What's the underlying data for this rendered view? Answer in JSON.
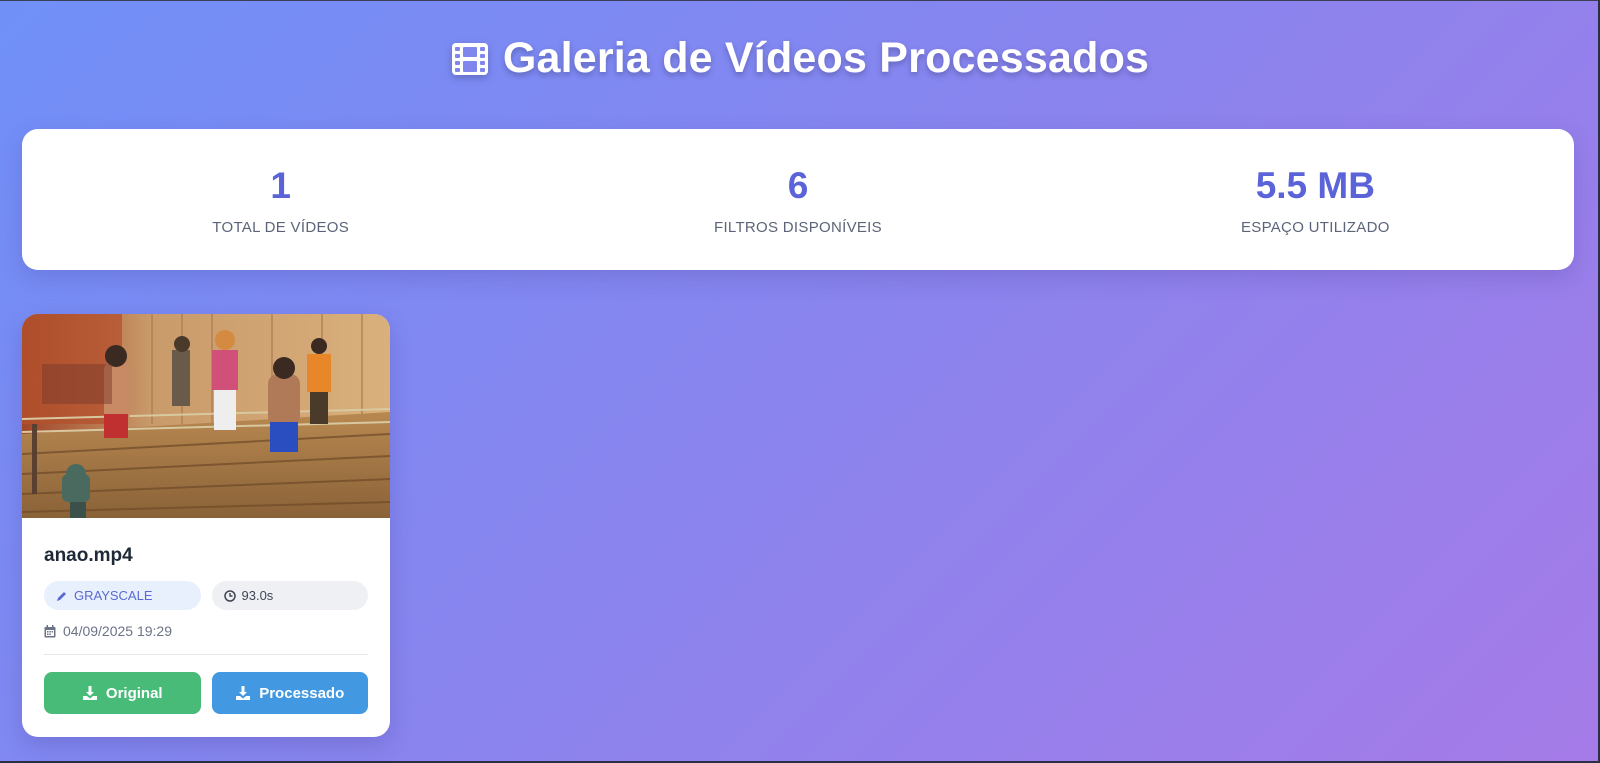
{
  "header": {
    "title": "Galeria de Vídeos Processados",
    "icon": "film-icon"
  },
  "stats": [
    {
      "value": "1",
      "label": "TOTAL DE VÍDEOS"
    },
    {
      "value": "6",
      "label": "FILTROS DISPONÍVEIS"
    },
    {
      "value": "5.5 MB",
      "label": "ESPAÇO UTILIZADO"
    }
  ],
  "videos": [
    {
      "name": "anao.mp4",
      "filter": "GRAYSCALE",
      "duration": "93.0s",
      "date": "04/09/2025 19:29",
      "buttons": {
        "original": "Original",
        "processed": "Processado"
      }
    }
  ],
  "colors": {
    "accent": "#5a63d8",
    "download_original": "#48bb78",
    "download_processed": "#4299e1",
    "background_start": "#7090f8",
    "background_end": "#a57be8"
  }
}
